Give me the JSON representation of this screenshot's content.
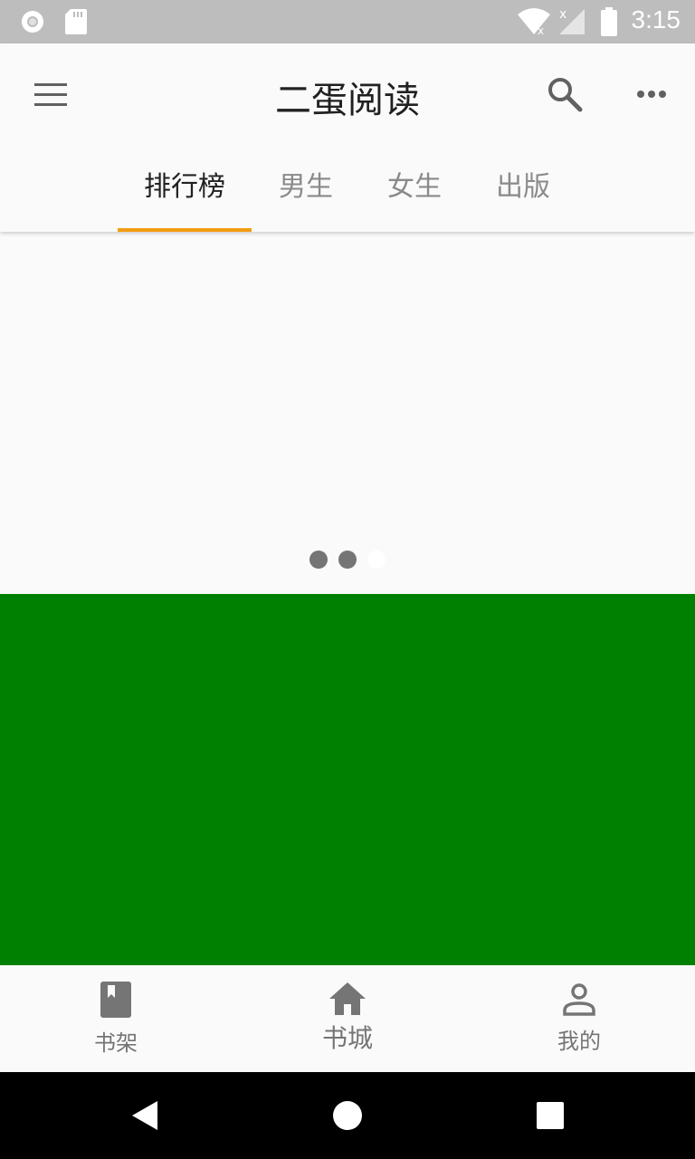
{
  "status_bar": {
    "time": "3:15"
  },
  "app_bar": {
    "title": "二蛋阅读",
    "tabs": [
      {
        "label": "排行榜",
        "active": true
      },
      {
        "label": "男生",
        "active": false
      },
      {
        "label": "女生",
        "active": false
      },
      {
        "label": "出版",
        "active": false
      }
    ]
  },
  "banner": {
    "indicator_count": 3,
    "active_index": 2,
    "banner_color": "#008000"
  },
  "bottom_nav": {
    "items": [
      {
        "label": "书架",
        "icon": "book-icon"
      },
      {
        "label": "书城",
        "icon": "home-icon"
      },
      {
        "label": "我的",
        "icon": "person-icon"
      }
    ]
  },
  "colors": {
    "accent": "#f39c12",
    "status_bar": "#bdbdbd",
    "banner": "#008000"
  }
}
